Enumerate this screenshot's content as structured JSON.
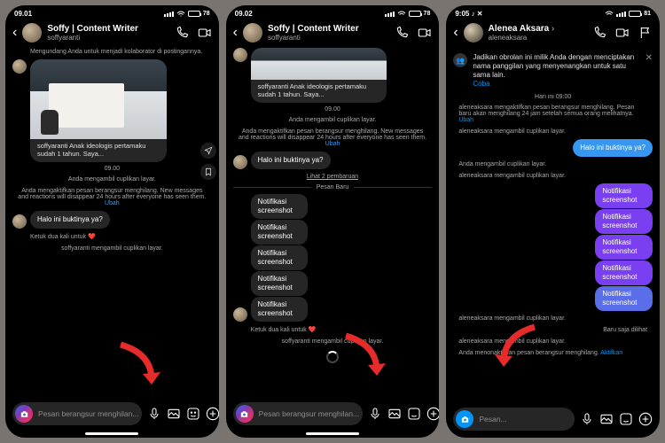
{
  "phones": [
    {
      "status": {
        "time": "09.01",
        "battery": "78"
      },
      "header": {
        "title": "Soffy | Content Writer",
        "subtitle": "soffyaranti"
      },
      "invite": "Mengundang Anda untuk menjadi kolaborator di postingannya.",
      "caption": "soffyaranti Anak ideologis pertamaku sudah 1 tahun. Saya...",
      "ts": "09.00",
      "sys1": "Anda mengambil cuplikan layar.",
      "vanish": "Anda mengaktifkan pesan berangsur menghilang. New messages and reactions will disappear 24 hours after everyone has seen them.",
      "ubah": "Ubah",
      "msg1": "Halo ini buktinya ya?",
      "tap": "Ketuk dua kali untuk ❤️",
      "shot": "soffyaranti mengambil cuplikan layar.",
      "placeholder": "Pesan berangsur menghilan..."
    },
    {
      "status": {
        "time": "09.02",
        "battery": "78"
      },
      "header": {
        "title": "Soffy | Content Writer",
        "subtitle": "soffyaranti"
      },
      "caption": "soffyaranti Anak ideologis pertamaku sudah 1 tahun. Saya...",
      "ts": "09.00",
      "sys1": "Anda mengambil cuplikan layar.",
      "vanish": "Anda mengaktifkan pesan berangsur menghilang. New messages and reactions will disappear 24 hours after everyone has seen them.",
      "ubah": "Ubah",
      "msg1": "Halo ini buktinya ya?",
      "lihat": "Lihat 2 pembaruan",
      "sep": "Pesan Baru",
      "notif": "Notifikasi screenshot",
      "tap": "Ketuk dua kali untuk ❤️",
      "shot": "soffyaranti mengambil cuplikan layar.",
      "placeholder": "Pesan berangsur menghilan..."
    },
    {
      "status": {
        "time": "9:05",
        "battery": "81"
      },
      "header": {
        "title": "Alenea Aksara",
        "subtitle": "aleneaksara"
      },
      "tip": "Jadikan obrolan ini milik Anda dengan menciptakan nama panggilan yang menyenangkan untuk satu sama lain.",
      "coba": "Coba",
      "ts": "Hari ini 09:00",
      "vanish1": "aleneaksara mengaktifkan pesan berangsur menghilang. Pesan baru akan menghilang 24 jam setelah semua orang melihatnya.",
      "ubah": "Ubah",
      "shot_a": "aleneaksara mengambil cuplikan layar.",
      "msg1": "Halo ini buktinya ya?",
      "shot_you": "Anda mengambil cuplikan layar.",
      "notif": "Notifikasi screenshot",
      "seen": "Baru saja dilihat",
      "deact": "Anda menonaktifkan pesan berangsur menghilang.",
      "aktif": "Aktifkan",
      "placeholder": "Pesan..."
    }
  ]
}
